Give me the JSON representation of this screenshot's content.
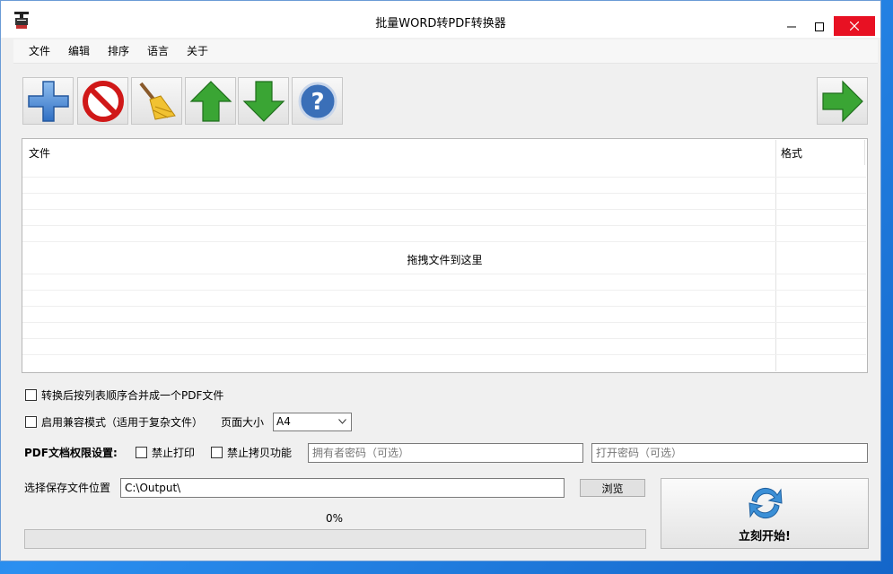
{
  "window": {
    "title": "批量WORD转PDF转换器",
    "controls": {
      "minimize": "minimize",
      "maximize": "maximize",
      "close": "close"
    }
  },
  "menu": [
    "文件",
    "编辑",
    "排序",
    "语言",
    "关于"
  ],
  "toolbar": {
    "buttons": [
      {
        "icon": "add-plus-icon"
      },
      {
        "icon": "remove-no-icon"
      },
      {
        "icon": "clear-broom-icon"
      },
      {
        "icon": "move-up-arrow-icon"
      },
      {
        "icon": "move-down-arrow-icon"
      },
      {
        "icon": "help-question-icon"
      },
      {
        "icon": "next-right-arrow-icon"
      }
    ]
  },
  "file_list": {
    "columns": [
      "文件",
      "格式"
    ],
    "drop_hint": "拖拽文件到这里",
    "rows": []
  },
  "options": {
    "merge_label": "转换后按列表顺序合并成一个PDF文件",
    "merge_checked": false,
    "compat_label": "启用兼容模式（适用于复杂文件）",
    "compat_checked": false,
    "page_size_label": "页面大小",
    "page_size_value": "A4"
  },
  "permissions": {
    "heading": "PDF文档权限设置:",
    "no_print_label": "禁止打印",
    "no_print_checked": false,
    "no_copy_label": "禁止拷贝功能",
    "no_copy_checked": false,
    "owner_password_placeholder": "拥有者密码（可选）",
    "open_password_placeholder": "打开密码（可选）"
  },
  "output": {
    "label": "选择保存文件位置",
    "path": "C:\\Output\\",
    "browse_label": "浏览"
  },
  "progress": {
    "text": "0%",
    "fraction": 0
  },
  "start_button": {
    "label": "立刻开始!"
  },
  "colors": {
    "close_red": "#e81123",
    "accent_blue": "#2f6fc4",
    "arrow_green": "#3aa534"
  }
}
